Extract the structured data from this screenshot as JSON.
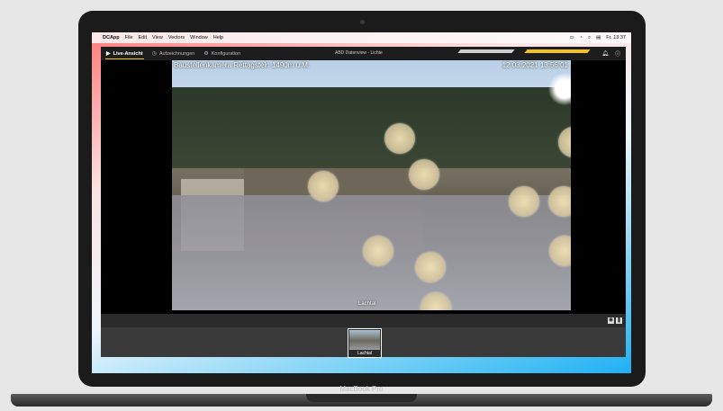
{
  "menubar": {
    "apple_icon": "apple-icon",
    "items": [
      "DCApp",
      "File",
      "Edit",
      "View",
      "Vectors",
      "Window",
      "Help"
    ],
    "clock": "Fr. 13:37",
    "status_icons": [
      "wifi-icon",
      "battery-icon",
      "search-icon",
      "control-center-icon"
    ]
  },
  "app": {
    "window_title": "ABD Datenview - Lichte",
    "tabs": [
      {
        "label": "Live-Ansicht",
        "icon": "play-icon",
        "active": true
      },
      {
        "label": "Aufzeichnungen",
        "icon": "history-icon",
        "active": false
      },
      {
        "label": "Konfiguration",
        "icon": "gear-icon",
        "active": false
      }
    ],
    "header_icons": [
      "bell-icon",
      "info-icon"
    ],
    "accent": "#f3c21a"
  },
  "camera": {
    "overlay_title": "Baustellenkamera Rettagstein 1490m ü.M.",
    "overlay_time": "12.03.2021 13:56:01",
    "location_label": "Lachtal"
  },
  "controls": {
    "snapshot_icon": "camera-icon",
    "pause_icon": "pause-icon"
  },
  "thumbnails": [
    {
      "label": "Lachtal"
    }
  ],
  "laptop": {
    "brand": "MacBook Pro"
  }
}
